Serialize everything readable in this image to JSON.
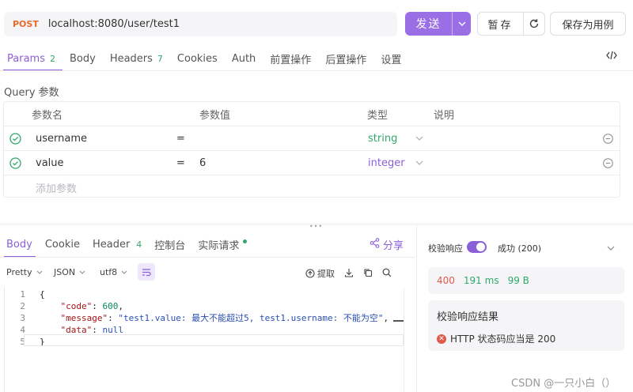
{
  "request": {
    "method": "POST",
    "url": "localhost:8080/user/test1",
    "send_label": "发送",
    "save_label": "暂存",
    "save_case_label": "保存为用例"
  },
  "tabs": [
    {
      "label": "Params",
      "badge": "2"
    },
    {
      "label": "Body",
      "badge": ""
    },
    {
      "label": "Headers",
      "badge": "7"
    },
    {
      "label": "Cookies",
      "badge": ""
    },
    {
      "label": "Auth",
      "badge": ""
    },
    {
      "label": "前置操作",
      "badge": ""
    },
    {
      "label": "后置操作",
      "badge": ""
    },
    {
      "label": "设置",
      "badge": ""
    }
  ],
  "query": {
    "title": "Query 参数",
    "headers": {
      "name": "参数名",
      "value": "参数值",
      "type": "类型",
      "desc": "说明"
    },
    "rows": [
      {
        "name": "username",
        "eq": "=",
        "value": "",
        "type": "string"
      },
      {
        "name": "value",
        "eq": "=",
        "value": "6",
        "type": "integer"
      }
    ],
    "add_placeholder": "添加参数"
  },
  "response": {
    "tabs": [
      {
        "label": "Body",
        "badge": ""
      },
      {
        "label": "Cookie",
        "badge": ""
      },
      {
        "label": "Header",
        "badge": "4"
      },
      {
        "label": "控制台",
        "badge": ""
      },
      {
        "label": "实际请求",
        "badge": ""
      }
    ],
    "share_label": "分享",
    "format": {
      "pretty": "Pretty",
      "lang": "JSON",
      "encoding": "utf8"
    },
    "extract_label": "提取",
    "line_numbers": [
      "1",
      "2",
      "3",
      "4",
      "5"
    ],
    "body": {
      "code_key": "\"code\"",
      "code_value": "600",
      "message_key": "\"message\"",
      "message_value": "\"test1.value: 最大不能超过5, test1.username: 不能为空\"",
      "data_key": "\"data\"",
      "data_value": "null"
    }
  },
  "validation": {
    "label": "校验响应",
    "enabled": true,
    "status": "成功 (200)",
    "status_code": "400",
    "time": "191 ms",
    "size": "99 B",
    "result_title": "校验响应结果",
    "result_item": "HTTP 状态码应当是 200"
  },
  "watermark": "CSDN @一只小白（）",
  "colors": {
    "accent": "#8a5fd8",
    "success": "#31a86b",
    "error": "#e05a4e",
    "method": "#e8692c"
  }
}
